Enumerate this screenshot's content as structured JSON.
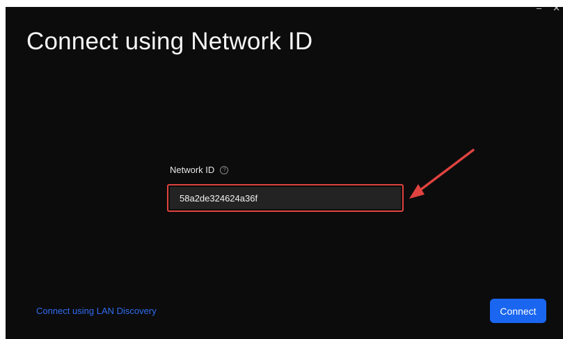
{
  "window": {
    "title": "Connect using Network ID",
    "minimize_glyph": "–",
    "close_glyph": "✕"
  },
  "field": {
    "label": "Network ID",
    "help_icon": "?",
    "value": "58a2de324624a36f"
  },
  "footer": {
    "lan_link": "Connect using LAN Discovery",
    "connect_button": "Connect"
  },
  "colors": {
    "background": "#0c0c0c",
    "accent": "#1a66f0",
    "link": "#2f6df2",
    "annotation": "#e0433f"
  }
}
